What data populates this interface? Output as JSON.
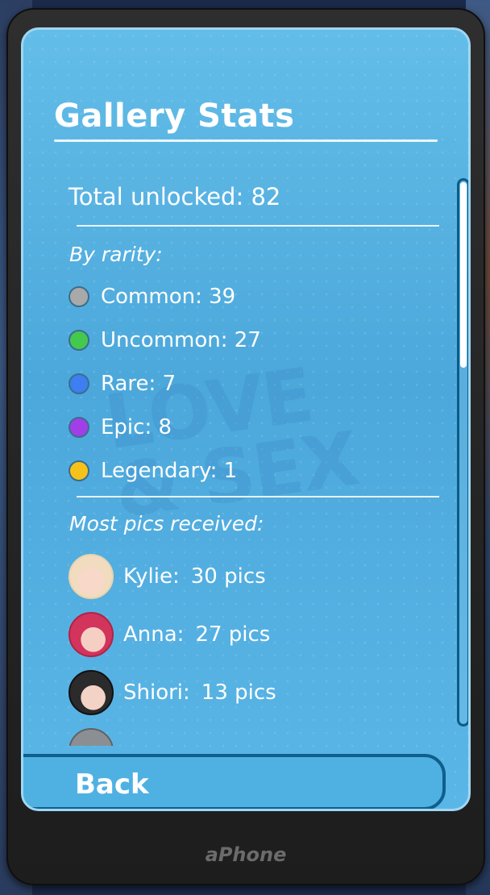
{
  "header": {
    "title": "Gallery Stats"
  },
  "total": {
    "label": "Total unlocked: 82"
  },
  "rarity": {
    "heading": "By rarity:",
    "items": [
      {
        "label": "Common: 39",
        "color": "#a9a9a9"
      },
      {
        "label": "Uncommon: 27",
        "color": "#44c94f"
      },
      {
        "label": "Rare: 7",
        "color": "#3d7ef0"
      },
      {
        "label": "Epic: 8",
        "color": "#a13ee8"
      },
      {
        "label": "Legendary: 1",
        "color": "#f6c21a"
      }
    ]
  },
  "most_pics": {
    "heading": "Most pics received:",
    "items": [
      {
        "name": "Kylie:",
        "count": "30 pics",
        "avatar_icon": "kylie-avatar-icon"
      },
      {
        "name": "Anna:",
        "count": "27 pics",
        "avatar_icon": "anna-avatar-icon"
      },
      {
        "name": "Shiori:",
        "count": "13 pics",
        "avatar_icon": "shiori-avatar-icon"
      }
    ]
  },
  "footer": {
    "back_label": "Back",
    "brand": "aPhone"
  },
  "watermark": {
    "text": "LOVE & SEX"
  }
}
